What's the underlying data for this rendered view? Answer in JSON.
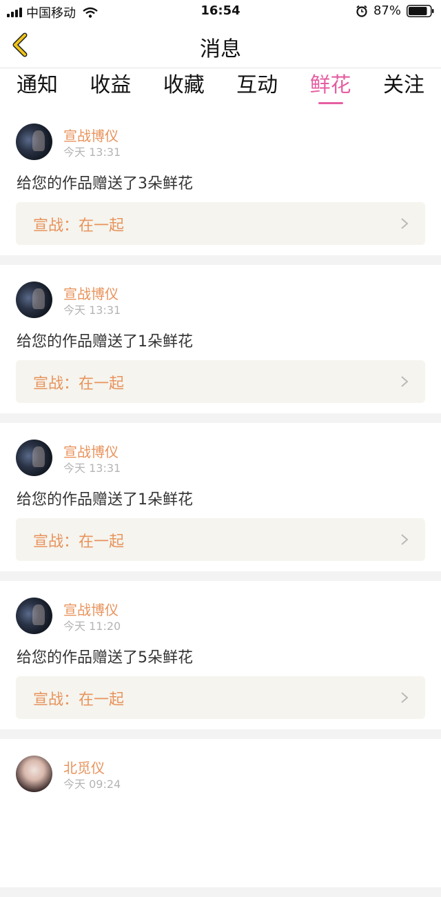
{
  "status_bar": {
    "carrier": "中国移动",
    "time": "16:54",
    "battery": "87%",
    "battery_level": 0.87
  },
  "header": {
    "title": "消息"
  },
  "tabs": [
    {
      "label": "通知",
      "active": false
    },
    {
      "label": "收益",
      "active": false
    },
    {
      "label": "收藏",
      "active": false
    },
    {
      "label": "互动",
      "active": false
    },
    {
      "label": "鲜花",
      "active": true
    },
    {
      "label": "关注",
      "active": false
    }
  ],
  "notifications": [
    {
      "username": "宣战博仪",
      "time": "今天 13:31",
      "message": "给您的作品赠送了3朵鲜花",
      "work": "宣战：在一起",
      "avatar": "dark"
    },
    {
      "username": "宣战博仪",
      "time": "今天 13:31",
      "message": "给您的作品赠送了1朵鲜花",
      "work": "宣战：在一起",
      "avatar": "dark"
    },
    {
      "username": "宣战博仪",
      "time": "今天 13:31",
      "message": "给您的作品赠送了1朵鲜花",
      "work": "宣战：在一起",
      "avatar": "dark"
    },
    {
      "username": "宣战博仪",
      "time": "今天 11:20",
      "message": "给您的作品赠送了5朵鲜花",
      "work": "宣战：在一起",
      "avatar": "dark"
    },
    {
      "username": "北觅仪",
      "time": "今天 09:24",
      "message": "",
      "work": "",
      "avatar": "light"
    }
  ],
  "colors": {
    "accent": "#e55ea2",
    "username": "#e8935c",
    "back_arrow": "#f0c419"
  }
}
